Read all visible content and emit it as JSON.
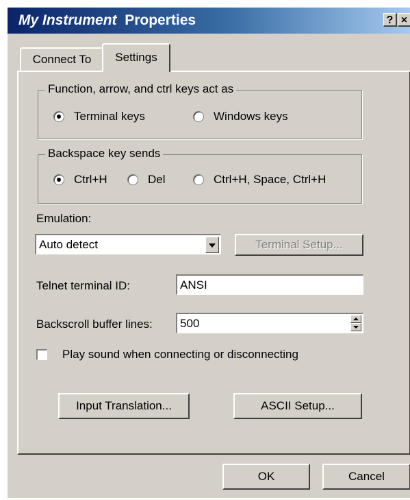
{
  "window": {
    "title_italic": "My Instrument",
    "title_rest": "Properties",
    "help_label": "?",
    "close_label": "×"
  },
  "tabs": [
    {
      "label": "Connect To",
      "active": false
    },
    {
      "label": "Settings",
      "active": true
    }
  ],
  "keys_group": {
    "label": "Function, arrow, and ctrl keys act as",
    "options": [
      {
        "label": "Terminal keys",
        "selected": true
      },
      {
        "label": "Windows keys",
        "selected": false
      }
    ]
  },
  "backspace_group": {
    "label": "Backspace key sends",
    "options": [
      {
        "label": "Ctrl+H",
        "selected": true
      },
      {
        "label": "Del",
        "selected": false
      },
      {
        "label": "Ctrl+H, Space, Ctrl+H",
        "selected": false
      }
    ]
  },
  "emulation": {
    "label": "Emulation:",
    "value": "Auto detect",
    "terminal_setup_label": "Terminal Setup..."
  },
  "telnet": {
    "label": "Telnet terminal ID:",
    "value": "ANSI"
  },
  "backscroll": {
    "label": "Backscroll buffer lines:",
    "value": "500"
  },
  "sound": {
    "label": "Play sound when connecting or disconnecting",
    "checked": false
  },
  "buttons": {
    "input_translation": "Input Translation...",
    "ascii_setup": "ASCII Setup...",
    "ok": "OK",
    "cancel": "Cancel"
  }
}
